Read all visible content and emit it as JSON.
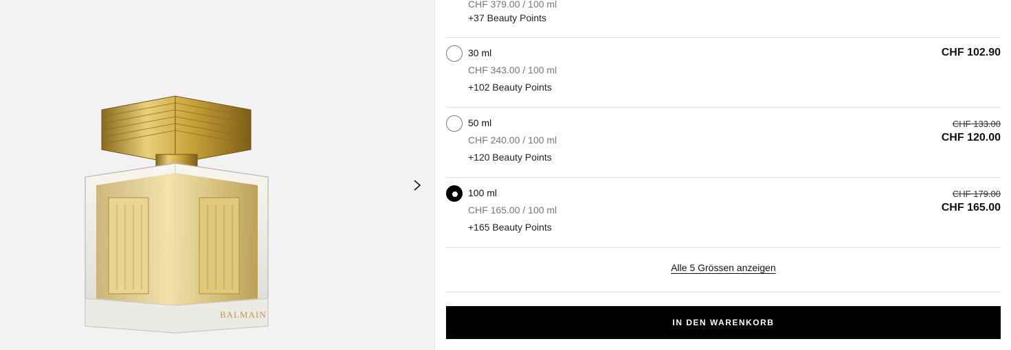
{
  "gallery": {
    "image_alt": "Balmain perfume bottle",
    "brand_mark": "BALMAIN",
    "next_icon": "chevron-right-icon"
  },
  "variants": [
    {
      "size": "",
      "unit_price": "CHF 379.00 / 100 ml",
      "points": "+37 Beauty Points",
      "old_price": "",
      "price": "",
      "selected": false
    },
    {
      "size": "30 ml",
      "unit_price": "CHF 343.00 / 100 ml",
      "points": "+102 Beauty Points",
      "old_price": "",
      "price": "CHF 102.90",
      "selected": false
    },
    {
      "size": "50 ml",
      "unit_price": "CHF 240.00 / 100 ml",
      "points": "+120 Beauty Points",
      "old_price": "CHF 133.00",
      "price": "CHF 120.00",
      "selected": false
    },
    {
      "size": "100 ml",
      "unit_price": "CHF 165.00 / 100 ml",
      "points": "+165 Beauty Points",
      "old_price": "CHF 179.00",
      "price": "CHF 165.00",
      "selected": true
    }
  ],
  "show_all_label": "Alle 5 Grössen anzeigen",
  "cart_button_label": "IN DEN WARENKORB",
  "colors": {
    "button_bg": "#000000",
    "gallery_bg": "#f2f2f2",
    "gold": "#c9a33a"
  }
}
